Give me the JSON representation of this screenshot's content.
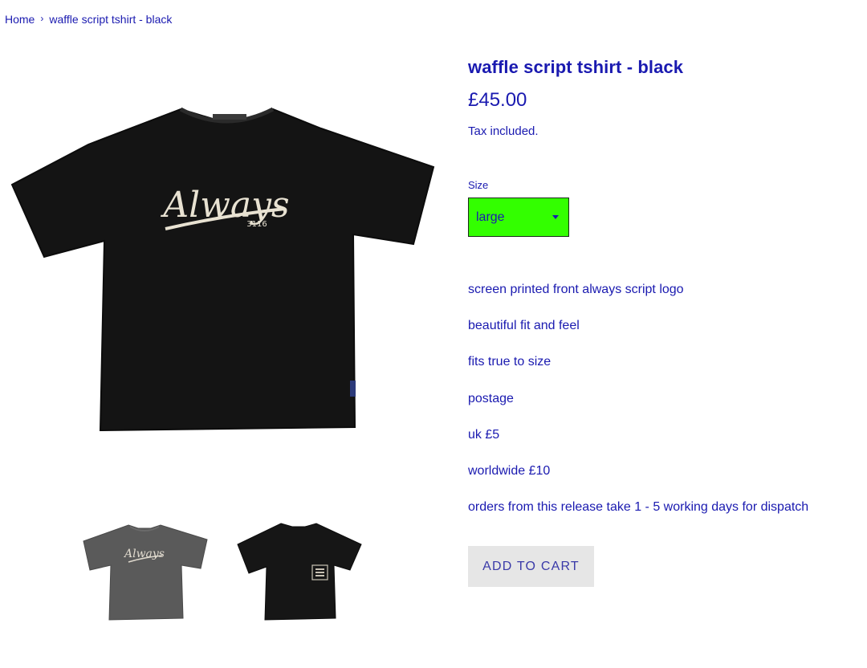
{
  "breadcrumb": {
    "home": "Home",
    "separator": "›",
    "current": "waffle script tshirt - black"
  },
  "product": {
    "title": "waffle script tshirt - black",
    "price": "£45.00",
    "tax_note": "Tax included.",
    "main_image_logo": "Always",
    "main_image_logo_sub": "3116"
  },
  "size": {
    "label": "Size",
    "selected": "large",
    "color": "#33ff00"
  },
  "description": [
    "screen printed front always script logo",
    "beautiful fit and feel",
    "fits true to size",
    "postage",
    "uk £5",
    "worldwide £10",
    "orders from this release take 1 - 5 working days for dispatch"
  ],
  "actions": {
    "add_to_cart": "ADD TO CART"
  },
  "thumbnails": [
    {
      "name": "grey front",
      "color": "#5a5a5a"
    },
    {
      "name": "black back",
      "color": "#161616"
    }
  ],
  "colors": {
    "text": "#1a1ab0",
    "shirt": "#141414",
    "print": "#e8e2d2"
  }
}
